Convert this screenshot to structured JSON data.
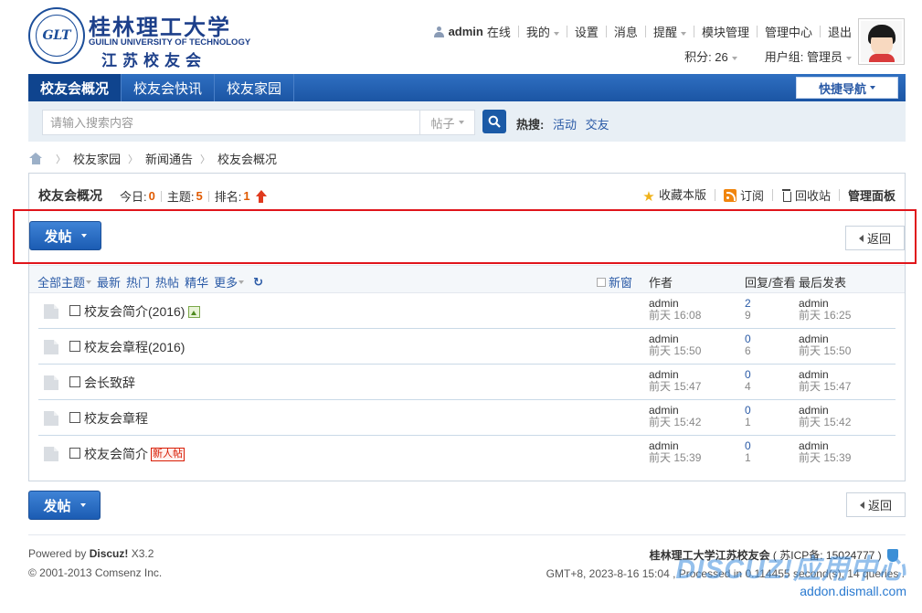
{
  "logo": {
    "seal_text": "GLT",
    "cn_name": "桂林理工大学",
    "en_name": "GUILIN UNIVERSITY OF TECHNOLOGY",
    "club_name": "江苏校友会"
  },
  "user": {
    "username": "admin",
    "status": "在线",
    "links": [
      "我的",
      "设置",
      "消息",
      "提醒",
      "模块管理",
      "管理中心",
      "退出"
    ],
    "points_label": "积分: 26",
    "group_label": "用户组: 管理员"
  },
  "nav": {
    "items": [
      "校友会概况",
      "校友会快讯",
      "校友家园"
    ],
    "quick_nav": "快捷导航"
  },
  "search": {
    "placeholder": "请输入搜索内容",
    "type": "帖子",
    "hot_label": "热搜:",
    "hot_terms": [
      "活动",
      "交友"
    ]
  },
  "breadcrumb": [
    "校友家园",
    "新闻通告",
    "校友会概况"
  ],
  "forum": {
    "title": "校友会概况",
    "today_label": "今日:",
    "today": "0",
    "threads_label": "主题:",
    "threads": "5",
    "rank_label": "排名:",
    "rank": "1",
    "actions": {
      "favorite": "收藏本版",
      "subscribe": "订阅",
      "recycle": "回收站",
      "admin_panel": "管理面板"
    }
  },
  "buttons": {
    "post": "发帖",
    "back": "返回"
  },
  "list_header": {
    "filters": [
      "全部主题",
      "最新",
      "热门",
      "热帖",
      "精华",
      "更多"
    ],
    "new_window": "新窗",
    "author": "作者",
    "replies_views": "回复/查看",
    "last_post": "最后发表"
  },
  "threads": [
    {
      "title": "校友会简介(2016)",
      "author": "admin",
      "author_time": "前天 16:08",
      "replies": "2",
      "views": "9",
      "last_user": "admin",
      "last_time": "前天 16:25",
      "badge": "",
      "has_image": true
    },
    {
      "title": "校友会章程(2016)",
      "author": "admin",
      "author_time": "前天 15:50",
      "replies": "0",
      "views": "6",
      "last_user": "admin",
      "last_time": "前天 15:50",
      "badge": "",
      "has_image": false
    },
    {
      "title": "会长致辞",
      "author": "admin",
      "author_time": "前天 15:47",
      "replies": "0",
      "views": "4",
      "last_user": "admin",
      "last_time": "前天 15:47",
      "badge": "",
      "has_image": false
    },
    {
      "title": "校友会章程",
      "author": "admin",
      "author_time": "前天 15:42",
      "replies": "0",
      "views": "1",
      "last_user": "admin",
      "last_time": "前天 15:42",
      "badge": "",
      "has_image": false
    },
    {
      "title": "校友会简介",
      "author": "admin",
      "author_time": "前天 15:39",
      "replies": "0",
      "views": "1",
      "last_user": "admin",
      "last_time": "前天 15:39",
      "badge": "新人帖",
      "has_image": false
    }
  ],
  "footer": {
    "powered_prefix": "Powered by ",
    "powered_brand": "Discuz!",
    "version": " X3.2",
    "copyright": "© 2001-2013 Comsenz Inc.",
    "site_name": "桂林理工大学江苏校友会",
    "icp": "( 苏ICP备: 15024777 )",
    "gmt": "GMT+8, 2023-8-16 15:04 , Processed in 0.114455 second(s), 14 queries .",
    "watermark_big": "DISCUZ!应用中心",
    "watermark_small": "addon.dismall.com"
  },
  "colors": {
    "brand_blue": "#1b55a4",
    "highlight_red": "#e0151b",
    "stat_orange": "#e05a00"
  }
}
